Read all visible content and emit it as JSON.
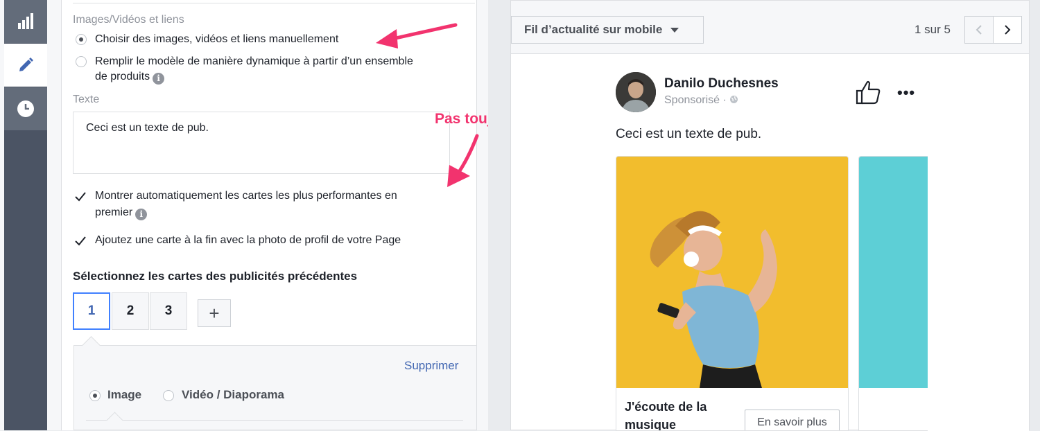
{
  "rail": {
    "items": [
      {
        "name": "stats",
        "icon": "bar-chart-icon"
      },
      {
        "name": "edit",
        "icon": "pencil-icon",
        "active": true
      },
      {
        "name": "history",
        "icon": "clock-icon"
      }
    ]
  },
  "editor": {
    "media_section_label": "Images/Vidéos et liens",
    "radio_manual": "Choisir des images, vidéos et liens manuellement",
    "radio_dynamic_line1": "Remplir le modèle de manière dynamique à partir d’un ensemble",
    "radio_dynamic_line2": "de produits",
    "text_label": "Texte",
    "text_value": "Ceci est un texte de pub.",
    "check_auto_line1": "Montrer automatiquement les cartes les plus performantes en",
    "check_auto_line2": "premier",
    "check_end_card": "Ajoutez une carte à la fin avec la photo de profil de votre Page",
    "cards_heading": "Sélectionnez les cartes des publicités précédentes",
    "card_tabs": [
      "1",
      "2",
      "3"
    ],
    "add_card": "+",
    "delete_link": "Supprimer",
    "media_type_image": "Image",
    "media_type_video": "Vidéo / Diaporama"
  },
  "annotations": {
    "note": "Pas toujours",
    "color": "#f2336e"
  },
  "preview": {
    "placement": "Fil d’actualité sur mobile",
    "pager": "1 sur 5",
    "author": "Danilo Duchesnes",
    "sponsored": "Sponsorisé · ",
    "post_text": "Ceci est un texte de pub.",
    "card_title_line1": "J'écoute de la",
    "card_title_line2": "musique",
    "cta_label": "En savoir plus"
  },
  "colors": {
    "accent": "#4267b2",
    "active_tab_border": "#4080ff",
    "rail": "#4b5464",
    "card_photo_bg": "#f2bd2d",
    "card2_photo_bg": "#5dcfd6"
  }
}
